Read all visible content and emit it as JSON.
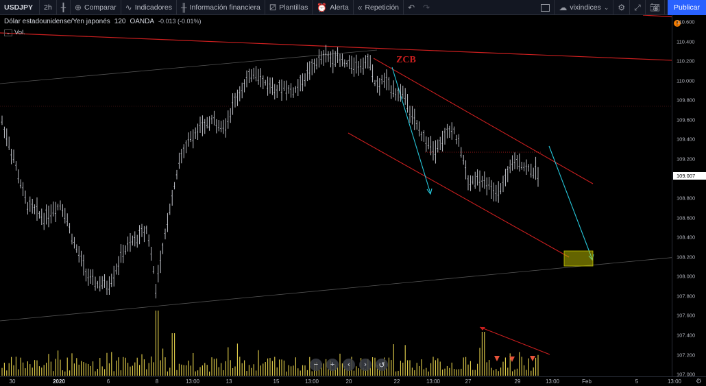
{
  "toolbar": {
    "symbol": "USDJPY",
    "interval": "2h",
    "compare": "Comparar",
    "indicators": "Indicadores",
    "financials": "Información financiera",
    "templates": "Plantillas",
    "alert": "Alerta",
    "replay": "Repetición",
    "layout_name": "vixindices",
    "publish": "Publicar"
  },
  "legend": {
    "title": "Dólar estadounidense/Yen japonés",
    "interval": "120",
    "exchange": "OANDA",
    "change": "-0.013 (-0.01%)",
    "volume": "Vol."
  },
  "annotation": {
    "zcb": "ZCB"
  },
  "price_axis": {
    "ticks": [
      "110.600",
      "110.400",
      "110.200",
      "110.000",
      "109.800",
      "109.600",
      "109.400",
      "109.200",
      "108.800",
      "108.600",
      "108.400",
      "108.200",
      "108.000",
      "107.800",
      "107.600",
      "107.400",
      "107.200",
      "107.000"
    ],
    "current_price": "109.007",
    "alert_icon": "!"
  },
  "time_axis": {
    "ticks": [
      {
        "label": "30",
        "bold": false
      },
      {
        "label": "2020",
        "bold": true
      },
      {
        "label": "6",
        "bold": false
      },
      {
        "label": "8",
        "bold": false
      },
      {
        "label": "13:00",
        "bold": false
      },
      {
        "label": "13",
        "bold": false
      },
      {
        "label": "15",
        "bold": false
      },
      {
        "label": "13:00",
        "bold": false
      },
      {
        "label": "20",
        "bold": false
      },
      {
        "label": "22",
        "bold": false
      },
      {
        "label": "13:00",
        "bold": false
      },
      {
        "label": "27",
        "bold": false
      },
      {
        "label": "29",
        "bold": false
      },
      {
        "label": "13:00",
        "bold": false
      },
      {
        "label": "Feb",
        "bold": false
      },
      {
        "label": "5",
        "bold": false
      },
      {
        "label": "13:00",
        "bold": false
      }
    ]
  },
  "colors": {
    "background": "#000000",
    "candle": "#d1d4dc",
    "volume": "#e8d44d",
    "trendline": "#cc1f1f",
    "arrow": "#26c6da",
    "target_box": "#c8c800"
  },
  "chart_data": {
    "type": "candlestick",
    "symbol": "USDJPY",
    "interval": "120",
    "exchange": "OANDA",
    "ylim": [
      107.0,
      110.6
    ],
    "last_price": 109.007,
    "close_path": [
      {
        "x": "30",
        "y": 109.5
      },
      {
        "x": "31",
        "y": 108.9
      },
      {
        "x": "2020",
        "y": 108.6
      },
      {
        "x": "3",
        "y": 108.1
      },
      {
        "x": "6",
        "y": 107.9
      },
      {
        "x": "7",
        "y": 108.45
      },
      {
        "x": "8",
        "y": 108.2
      },
      {
        "x": "9",
        "y": 109.2
      },
      {
        "x": "10",
        "y": 109.6
      },
      {
        "x": "13",
        "y": 109.8
      },
      {
        "x": "14",
        "y": 110.1
      },
      {
        "x": "15",
        "y": 109.9
      },
      {
        "x": "16",
        "y": 110.05
      },
      {
        "x": "17",
        "y": 110.2
      },
      {
        "x": "20",
        "y": 110.2
      },
      {
        "x": "21",
        "y": 109.95
      },
      {
        "x": "22",
        "y": 110.0
      },
      {
        "x": "23",
        "y": 109.4
      },
      {
        "x": "24",
        "y": 109.55
      },
      {
        "x": "27",
        "y": 108.95
      },
      {
        "x": "28",
        "y": 109.0
      },
      {
        "x": "29",
        "y": 109.15
      },
      {
        "x": "30",
        "y": 109.007
      }
    ]
  }
}
